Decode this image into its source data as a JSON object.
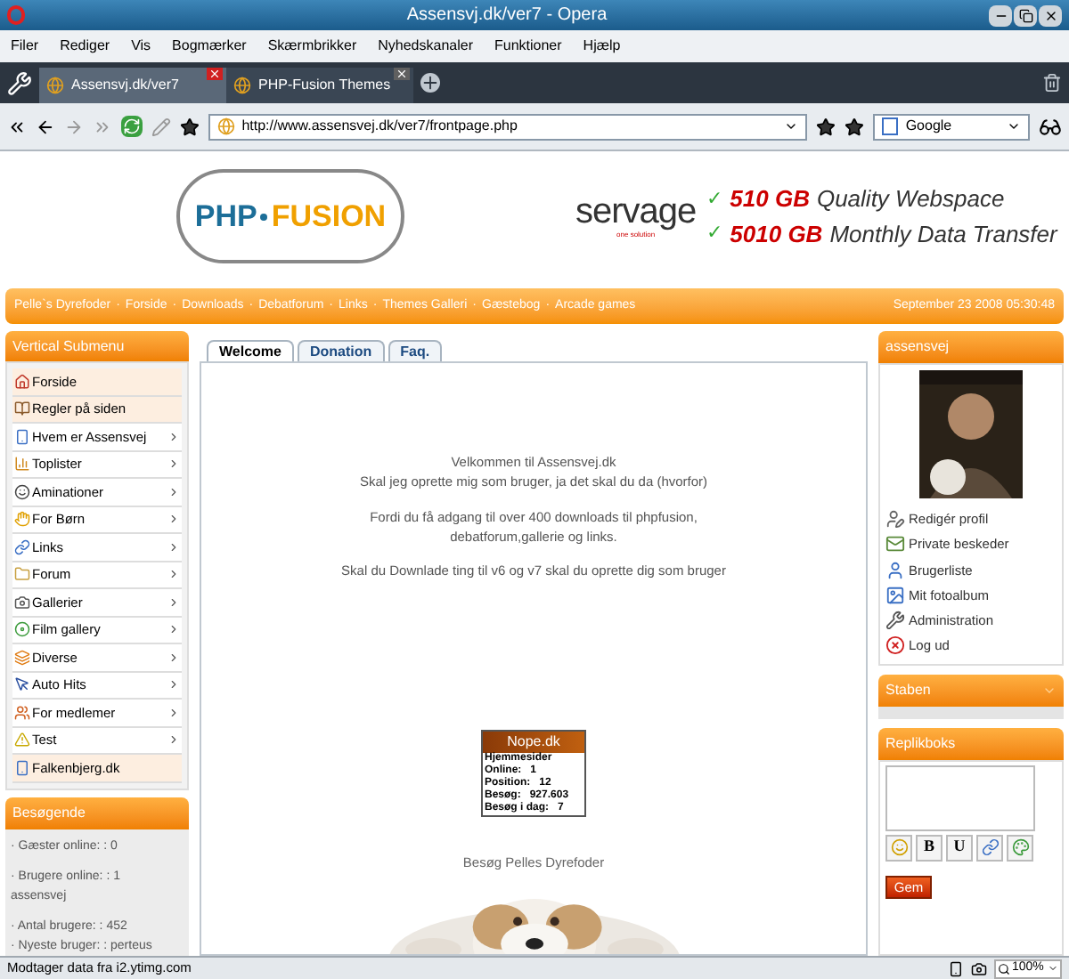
{
  "window": {
    "title": "Assensvj.dk/ver7 - Opera"
  },
  "menu": [
    "Filer",
    "Rediger",
    "Vis",
    "Bogmærker",
    "Skærmbrikker",
    "Nyhedskanaler",
    "Funktioner",
    "Hjælp"
  ],
  "tabs": [
    {
      "label": "Assensvj.dk/ver7",
      "selected": true
    },
    {
      "label": "PHP-Fusion Themes",
      "selected": false
    }
  ],
  "address": {
    "url": "http://www.assensvej.dk/ver7/frontpage.php"
  },
  "search": {
    "engine": "Google"
  },
  "banner": {
    "logo_left": "PHP",
    "logo_right": "FUSION",
    "brand": "servage",
    "brand_tagline": "one solution",
    "offers": [
      {
        "check": "✓",
        "amount": "510 GB",
        "text": "Quality Webspace"
      },
      {
        "check": "✓",
        "amount": "5010 GB",
        "text": "Monthly Data Transfer"
      }
    ]
  },
  "nav": {
    "links": [
      "Pelle`s Dyrefoder",
      "Forside",
      "Downloads",
      "Debatforum",
      "Links",
      "Themes Galleri",
      "Gæstebog",
      "Arcade games"
    ],
    "separator": "·",
    "date": "September 23 2008 05:30:48"
  },
  "left_menu": {
    "title": "Vertical Submenu",
    "items": [
      {
        "label": "Forside",
        "has_submenu": false
      },
      {
        "label": "Regler på siden",
        "has_submenu": false
      },
      {
        "label": "Hvem er Assensvej",
        "has_submenu": true
      },
      {
        "label": "Toplister",
        "has_submenu": true
      },
      {
        "label": "Aminationer",
        "has_submenu": true
      },
      {
        "label": "For Børn",
        "has_submenu": true
      },
      {
        "label": "Links",
        "has_submenu": true
      },
      {
        "label": "Forum",
        "has_submenu": true
      },
      {
        "label": "Gallerier",
        "has_submenu": true
      },
      {
        "label": "Film gallery",
        "has_submenu": true
      },
      {
        "label": "Diverse",
        "has_submenu": true
      },
      {
        "label": "Auto Hits",
        "has_submenu": true
      },
      {
        "label": "For medlemer",
        "has_submenu": true
      },
      {
        "label": "Test",
        "has_submenu": true
      },
      {
        "label": "Falkenbjerg.dk",
        "has_submenu": false
      }
    ]
  },
  "visitors": {
    "title": "Besøgende",
    "groups": [
      [
        "· Gæster online: : 0"
      ],
      [
        "· Brugere online: : 1",
        "assensvej"
      ],
      [
        "· Antal brugere: : 452",
        "· Nyeste bruger: : perteus"
      ]
    ]
  },
  "content_tabs": [
    {
      "label": "Welcome",
      "selected": true
    },
    {
      "label": "Donation",
      "selected": false
    },
    {
      "label": "Faq.",
      "selected": false
    }
  ],
  "welcome": {
    "paragraphs": [
      [
        "Velkommen til Assensvej.dk",
        "Skal jeg oprette mig som bruger, ja det skal du da (hvorfor)"
      ],
      [
        "Fordi du få adgang til over 400 downloads til phpfusion,",
        "debatforum,gallerie og links."
      ],
      [
        "Skal du Downlade ting til v6 og v7 skal du oprette dig som bruger"
      ]
    ],
    "counter": {
      "title": "Nope.dk",
      "lines": [
        "Hjemmesider",
        "Online:   1",
        "Position:   12",
        "Besøg:   927.603",
        "Besøg i dag:   7"
      ]
    },
    "caption": "Besøg Pelles Dyrefoder"
  },
  "user_panel": {
    "title": "assensvej",
    "links": [
      "Redigér profil",
      "Private beskeder",
      "Brugerliste",
      "Mit fotoalbum",
      "Administration",
      "Log ud"
    ]
  },
  "staff_panel": {
    "title": "Staben",
    "expanded": false
  },
  "shoutbox": {
    "title": "Replikboks",
    "format_buttons": [
      {
        "kind": "icon"
      },
      {
        "kind": "text",
        "label": "B"
      },
      {
        "kind": "text",
        "label": "U"
      },
      {
        "kind": "icon"
      },
      {
        "kind": "icon"
      }
    ],
    "save": "Gem"
  },
  "status_bar": {
    "text": "Modtager data fra i2.ytimg.com",
    "zoom": "100%"
  }
}
